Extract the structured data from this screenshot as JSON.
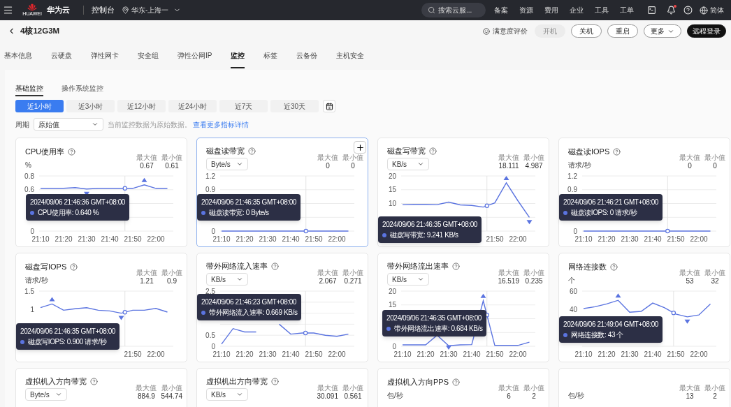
{
  "topbar": {
    "logo_text": "HUAWEI",
    "brand": "华为云",
    "console": "控制台",
    "region": "华东-上海一",
    "search": {
      "placeholder": "搜索云服..."
    },
    "links": [
      "备案",
      "资源",
      "费用",
      "企业",
      "工具",
      "工单"
    ],
    "notification_dot": true,
    "language": "简体"
  },
  "header": {
    "title": "4核12G3M",
    "feedback": "满意度评价",
    "buttons": [
      {
        "label": "开机",
        "kind": "disabled"
      },
      {
        "label": "关机",
        "kind": "outline"
      },
      {
        "label": "重启",
        "kind": "outline"
      },
      {
        "label": "更多",
        "kind": "dropdown"
      },
      {
        "label": "远程登录",
        "kind": "primary"
      }
    ]
  },
  "tabs": [
    {
      "label": "基本信息",
      "selected": false
    },
    {
      "label": "云硬盘",
      "selected": false
    },
    {
      "label": "弹性网卡",
      "selected": false
    },
    {
      "label": "安全组",
      "selected": false
    },
    {
      "label": "弹性公网IP",
      "selected": false
    },
    {
      "label": "监控",
      "selected": true
    },
    {
      "label": "标签",
      "selected": false
    },
    {
      "label": "云备份",
      "selected": false
    },
    {
      "label": "主机安全",
      "selected": false
    }
  ],
  "subtabs": [
    {
      "label": "基础监控",
      "selected": true
    },
    {
      "label": "操作系统监控",
      "selected": false
    }
  ],
  "ranges": [
    {
      "label": "近1小时",
      "selected": true
    },
    {
      "label": "近3小时",
      "selected": false
    },
    {
      "label": "近12小时",
      "selected": false
    },
    {
      "label": "近24小时",
      "selected": false
    },
    {
      "label": "近7天",
      "selected": false
    },
    {
      "label": "近30天",
      "selected": false
    }
  ],
  "period": {
    "label": "周期",
    "value": "原始值",
    "hint": "当前监控数据为原始数据。",
    "link": "查看更多指标详情"
  },
  "cards": [
    {
      "title": "CPU使用率",
      "selected": false,
      "unit": {
        "kind": "text",
        "text": "%"
      },
      "max_label": "最大值",
      "max": "0.67",
      "min_label": "最小值",
      "min": "0.61",
      "tooltip": {
        "time": "2024/09/06 21:46:36 GMT+08:00",
        "text": "CPU使用率: 0.640 %"
      },
      "chart_data": {
        "type": "line",
        "categories": [
          "21:10",
          null,
          "21:20",
          null,
          "21:30",
          null,
          "21:40",
          null,
          "21:50",
          null,
          "22:00",
          null
        ],
        "ylim": [
          0,
          0.8
        ],
        "yticks": [
          0,
          0.6,
          0.8
        ],
        "series": [
          {
            "color": "#5b74e0",
            "values": [
              0.62,
              0.62,
              0.62,
              0.63,
              0.61,
              0.62,
              0.62,
              0.62,
              0.62,
              0.67,
              0.62,
              0.62
            ]
          }
        ]
      }
    },
    {
      "title": "磁盘读带宽",
      "selected": true,
      "unit": {
        "kind": "select",
        "text": "Byte/s"
      },
      "max_label": "最大值",
      "max": "0",
      "min_label": "最小值",
      "min": "0",
      "tooltip": {
        "time": "2024/09/06 21:46:35 GMT+08:00",
        "text": "磁盘读带宽: 0 Byte/s"
      },
      "chart_data": {
        "type": "line",
        "categories": [
          "21:10",
          null,
          "21:20",
          null,
          "21:30",
          null,
          "21:40",
          null,
          "21:50",
          null,
          "22:00",
          null
        ],
        "ylim": [
          0,
          1.2
        ],
        "yticks": [
          0,
          0.9,
          1.2
        ],
        "series": [
          {
            "color": "#5b74e0",
            "values": [
              0,
              0,
              0,
              0,
              0,
              0,
              0,
              0,
              0,
              0,
              0,
              0
            ]
          }
        ]
      }
    },
    {
      "title": "磁盘写带宽",
      "selected": false,
      "unit": {
        "kind": "select",
        "text": "KB/s"
      },
      "max_label": "最大值",
      "max": "18.111",
      "min_label": "最小值",
      "min": "4.987",
      "tooltip": {
        "time": "2024/09/06 21:46:35 GMT+08:00",
        "text": "磁盘写带宽: 9.241 KB/s"
      },
      "chart_data": {
        "type": "line",
        "categories": [
          null,
          null,
          null,
          null,
          null,
          null,
          null,
          null,
          "21:50",
          null,
          "22:00",
          null
        ],
        "ylim": [
          0,
          20
        ],
        "yticks": [
          10,
          15,
          20
        ],
        "series": [
          {
            "color": "#5b74e0",
            "values": [
              9.6,
              9.7,
              9.7,
              9.6,
              10.5,
              9.5,
              9.3,
              8.7,
              10.2,
              17.5,
              11,
              5
            ]
          }
        ]
      }
    },
    {
      "title": "磁盘读IOPS",
      "selected": false,
      "unit": {
        "kind": "text",
        "text": "请求/秒"
      },
      "max_label": "最大值",
      "max": "0",
      "min_label": "最小值",
      "min": "0",
      "tooltip": {
        "time": "2024/09/06 21:46:21 GMT+08:00",
        "text": "磁盘读IOPS: 0 请求/秒"
      },
      "chart_data": {
        "type": "line",
        "categories": [
          "21:10",
          null,
          "21:20",
          null,
          "21:30",
          null,
          "21:40",
          null,
          "21:50",
          null,
          "22:00",
          null
        ],
        "ylim": [
          0,
          1.2
        ],
        "yticks": [
          0,
          0.9,
          1.2
        ],
        "series": [
          {
            "color": "#5b74e0",
            "values": [
              0,
              0,
              0,
              0,
              0,
              0,
              0,
              0,
              0,
              0,
              0,
              0
            ]
          }
        ]
      }
    },
    {
      "title": "磁盘写IOPS",
      "selected": false,
      "unit": {
        "kind": "text",
        "text": "请求/秒"
      },
      "max_label": "最大值",
      "max": "1.21",
      "min_label": "最小值",
      "min": "0.9",
      "tooltip": {
        "time": "2024/09/06 21:46:35 GMT+08:00",
        "text": "磁盘写IOPS: 0.900 请求/秒"
      },
      "chart_data": {
        "type": "line",
        "categories": [
          null,
          null,
          null,
          null,
          null,
          null,
          null,
          null,
          "21:50",
          null,
          "22:00",
          null
        ],
        "ylim": [
          0,
          1.5
        ],
        "yticks": [
          1,
          1.5
        ],
        "series": [
          {
            "color": "#5b74e0",
            "values": [
              1.05,
              1.15,
              0.98,
              1.02,
              1.05,
              0.98,
              0.96,
              0.9,
              0.98,
              0.98,
              1.03,
              0.93
            ]
          }
        ]
      }
    },
    {
      "title": "带外网络流入速率",
      "selected": false,
      "unit": {
        "kind": "select",
        "text": "KB/s"
      },
      "max_label": "最大值",
      "max": "2.067",
      "min_label": "最小值",
      "min": "0.271",
      "tooltip": {
        "time": "2024/09/06 21:46:23 GMT+08:00",
        "text": "带外网络流入速率: 0.669 KB/s"
      },
      "chart_data": {
        "type": "line",
        "categories": [
          "21:10",
          null,
          "21:20",
          null,
          "21:30",
          null,
          "21:40",
          null,
          "21:50",
          null,
          "22:00",
          null
        ],
        "ylim": [
          0,
          2.5
        ],
        "yticks": [
          0,
          0.5,
          2.5
        ],
        "series": [
          {
            "color": "#5b74e0",
            "values": [
              0.1,
              0.8,
              0.65,
              0.65,
              null,
              1.0,
              0.55,
              0.6,
              0.6,
              0.5,
              0.45,
              0.55
            ]
          }
        ]
      }
    },
    {
      "title": "带外网络流出速率",
      "selected": false,
      "unit": {
        "kind": "select",
        "text": "KB/s"
      },
      "max_label": "最大值",
      "max": "16.519",
      "min_label": "最小值",
      "min": "0.235",
      "tooltip": {
        "time": "2024/09/06 21:46:35 GMT+08:00",
        "text": "带外网络流出速率: 0.684 KB/s"
      },
      "chart_data": {
        "type": "line",
        "categories": [
          "21:10",
          null,
          "21:20",
          null,
          "21:30",
          null,
          "21:40",
          null,
          "21:50",
          null,
          "22:00",
          null
        ],
        "ylim": [
          0,
          20
        ],
        "yticks": [
          0,
          15,
          20
        ],
        "series": [
          {
            "color": "#5b74e0",
            "values": [
              0.5,
              0.5,
              0.5,
              4,
              0.2,
              0.5,
              0.6,
              16.5,
              0.3,
              0.3,
              0.3,
              1.5
            ]
          }
        ]
      }
    },
    {
      "title": "网络连接数",
      "selected": false,
      "unit": {
        "kind": "text",
        "text": "个"
      },
      "max_label": "最大值",
      "max": "53",
      "min_label": "最小值",
      "min": "32",
      "tooltip": {
        "time": "2024/09/06 21:49:04 GMT+08:00",
        "text": "网络连接数: 43 个"
      },
      "chart_data": {
        "type": "line",
        "categories": [
          "21:10",
          null,
          "21:20",
          null,
          "21:30",
          null,
          "21:40",
          null,
          "21:50",
          null,
          "22:00",
          null
        ],
        "ylim": [
          0,
          60
        ],
        "yticks": [
          40,
          60
        ],
        "series": [
          {
            "color": "#5b74e0",
            "values": [
              41,
              43,
              46,
              50,
              37,
              38,
              47,
              42,
              35,
              32,
              34,
              46
            ]
          }
        ]
      }
    },
    {
      "title": "虚拟机入方向带宽",
      "selected": false,
      "unit": {
        "kind": "select",
        "text": "Byte/s"
      },
      "max_label": "最大值",
      "max": "884.9",
      "min_label": "最小值",
      "min": "544.74"
    },
    {
      "title": "虚拟机出方向带宽",
      "selected": false,
      "unit": {
        "kind": "select",
        "text": "KB/s"
      },
      "max_label": "最大值",
      "max": "30.091",
      "min_label": "最小值",
      "min": "0.561"
    },
    {
      "title": "虚拟机入方向PPS",
      "selected": false,
      "unit": {
        "kind": "text",
        "text": "包/秒"
      },
      "max_label": "最大值",
      "max": "6",
      "min_label": "最小值",
      "min": "2"
    },
    {
      "selected": false,
      "unit": {
        "kind": "text",
        "text": "包/秒"
      },
      "max_label": "最大值",
      "max": "13",
      "min_label": "最小值",
      "min": "2"
    }
  ]
}
